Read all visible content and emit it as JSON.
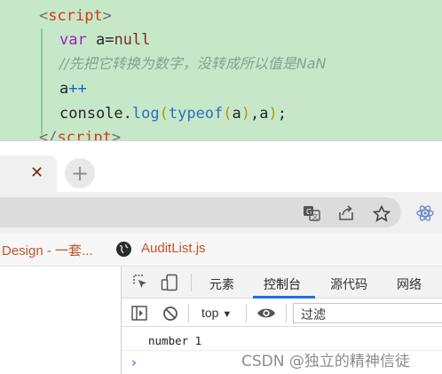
{
  "editor": {
    "lines": [
      {
        "open": "<",
        "name": "script",
        "close": ">"
      },
      {
        "kw": "var",
        "code": " a=",
        "val": "null"
      },
      {
        "comment": "//先把它转换为数字，没转成所以值是NaN"
      },
      {
        "var": "a",
        "op": "++"
      },
      {
        "obj": "console.",
        "method": "log",
        "p1": "(",
        "typeof": "typeof",
        "p2": "(",
        "arg": "a",
        "p3": ")",
        "rest": ",a",
        "p4": ")",
        "end": ";"
      },
      {
        "open": "</",
        "name": "script",
        "close": ">"
      }
    ]
  },
  "browser": {
    "tab_close_glyph": "✕",
    "new_tab_glyph": "+",
    "toolbar_icons": [
      "translate-icon",
      "share-icon",
      "star-icon",
      "extension-icon"
    ],
    "bookmarks": [
      {
        "label": "Design - 一套..."
      },
      {
        "label": "AuditList.js",
        "icon": "globe-icon"
      }
    ]
  },
  "devtools": {
    "tabs": [
      "元素",
      "控制台",
      "源代码",
      "网络"
    ],
    "active_tab": "控制台",
    "console_context": "top",
    "filter_placeholder": "过滤",
    "output": "number 1",
    "prompt": "›",
    "accent": "#1a73e8"
  },
  "watermark": "CSDN @独立的精神信徒"
}
